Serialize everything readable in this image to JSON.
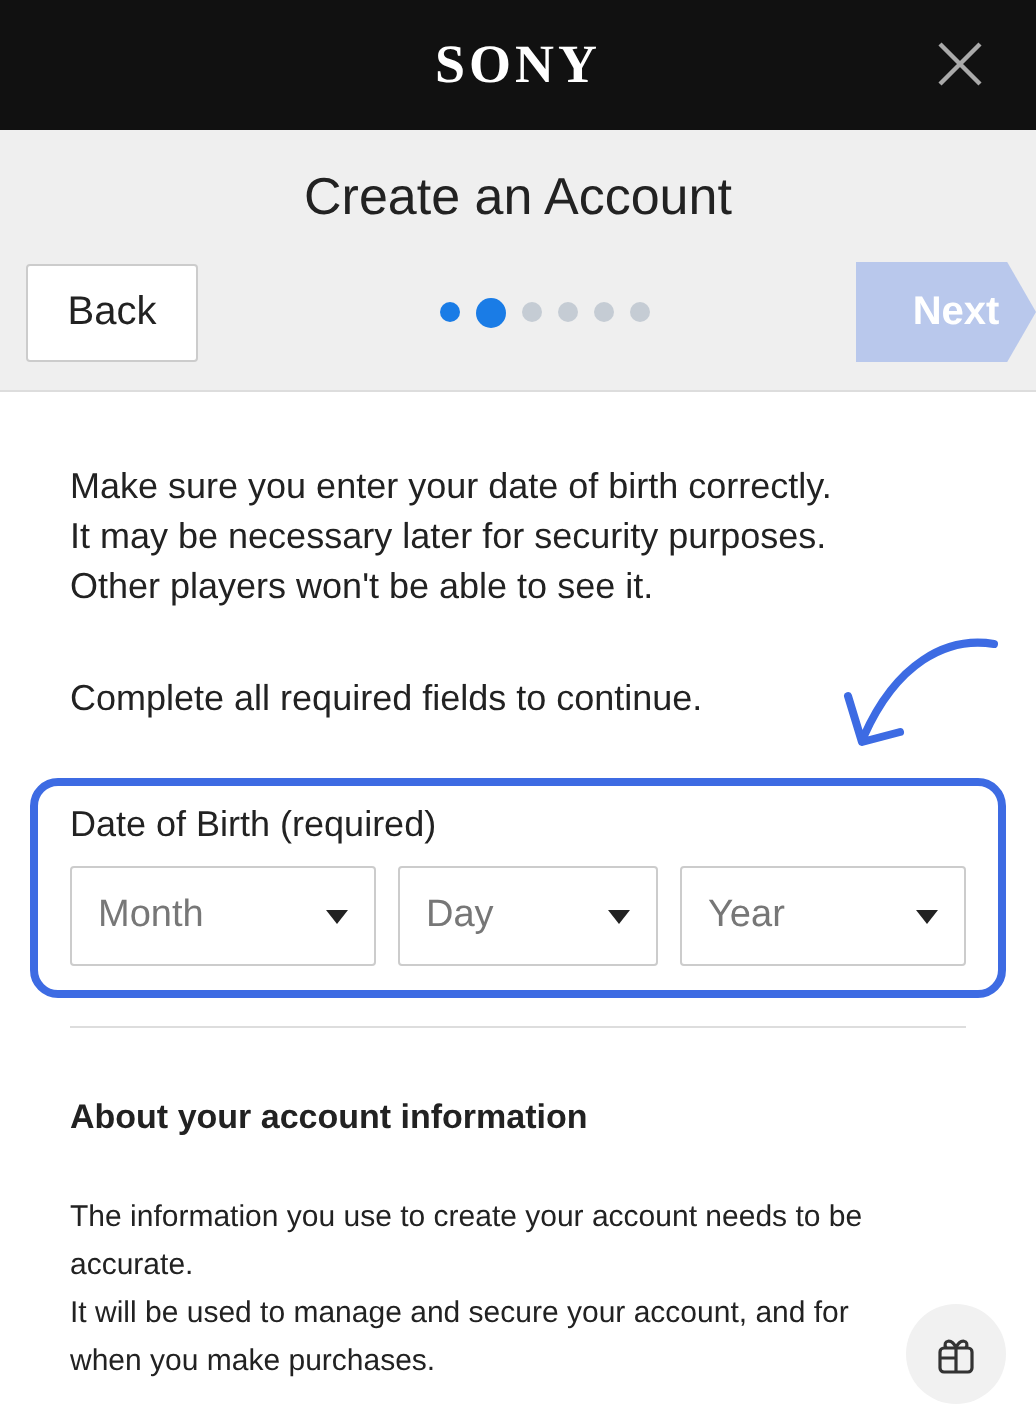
{
  "header": {
    "logo": "SONY"
  },
  "title": "Create an Account",
  "nav": {
    "back": "Back",
    "next": {
      "label": "Next",
      "disabled": true
    }
  },
  "steps": [
    {
      "kind": "done"
    },
    {
      "kind": "current"
    },
    {
      "kind": "pending"
    },
    {
      "kind": "pending"
    },
    {
      "kind": "pending"
    },
    {
      "kind": "pending"
    }
  ],
  "intro": [
    "Make sure you enter your date of birth correctly.",
    "It may be necessary later for security purposes.",
    "Other players won't be able to see it."
  ],
  "notice": "Complete all required fields to continue.",
  "date_of_birth": {
    "label": "Date of Birth (required)",
    "fields": [
      {
        "placeholder": "Month"
      },
      {
        "placeholder": "Day"
      },
      {
        "placeholder": "Year"
      }
    ]
  },
  "about": {
    "heading": "About your account information",
    "paragraphs": [
      "The information you use to create your account needs to be accurate.",
      "It will be used to manage and secure your account, and for when you make purchases."
    ]
  }
}
